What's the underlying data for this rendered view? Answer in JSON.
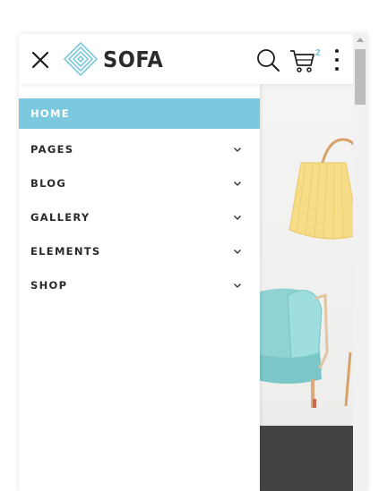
{
  "header": {
    "logo_text": "SOFA",
    "cart_count": "2",
    "icons": {
      "close": "close-icon",
      "logo": "logo-diamond-icon",
      "search": "search-icon",
      "cart": "cart-icon",
      "more": "more-vertical-icon"
    }
  },
  "menu": {
    "items": [
      {
        "label": "HOME",
        "active": true
      },
      {
        "label": "PAGES",
        "has_submenu": true
      },
      {
        "label": "BLOG",
        "has_submenu": true
      },
      {
        "label": "GALLERY",
        "has_submenu": true
      },
      {
        "label": "ELEMENTS",
        "has_submenu": true
      },
      {
        "label": "SHOP",
        "has_submenu": true
      }
    ]
  },
  "colors": {
    "accent": "#7cc8de",
    "text_dark": "#2a2a2a",
    "dark_band": "#434343",
    "lamp": "#f6dc86",
    "chair": "#8fd3d3"
  }
}
